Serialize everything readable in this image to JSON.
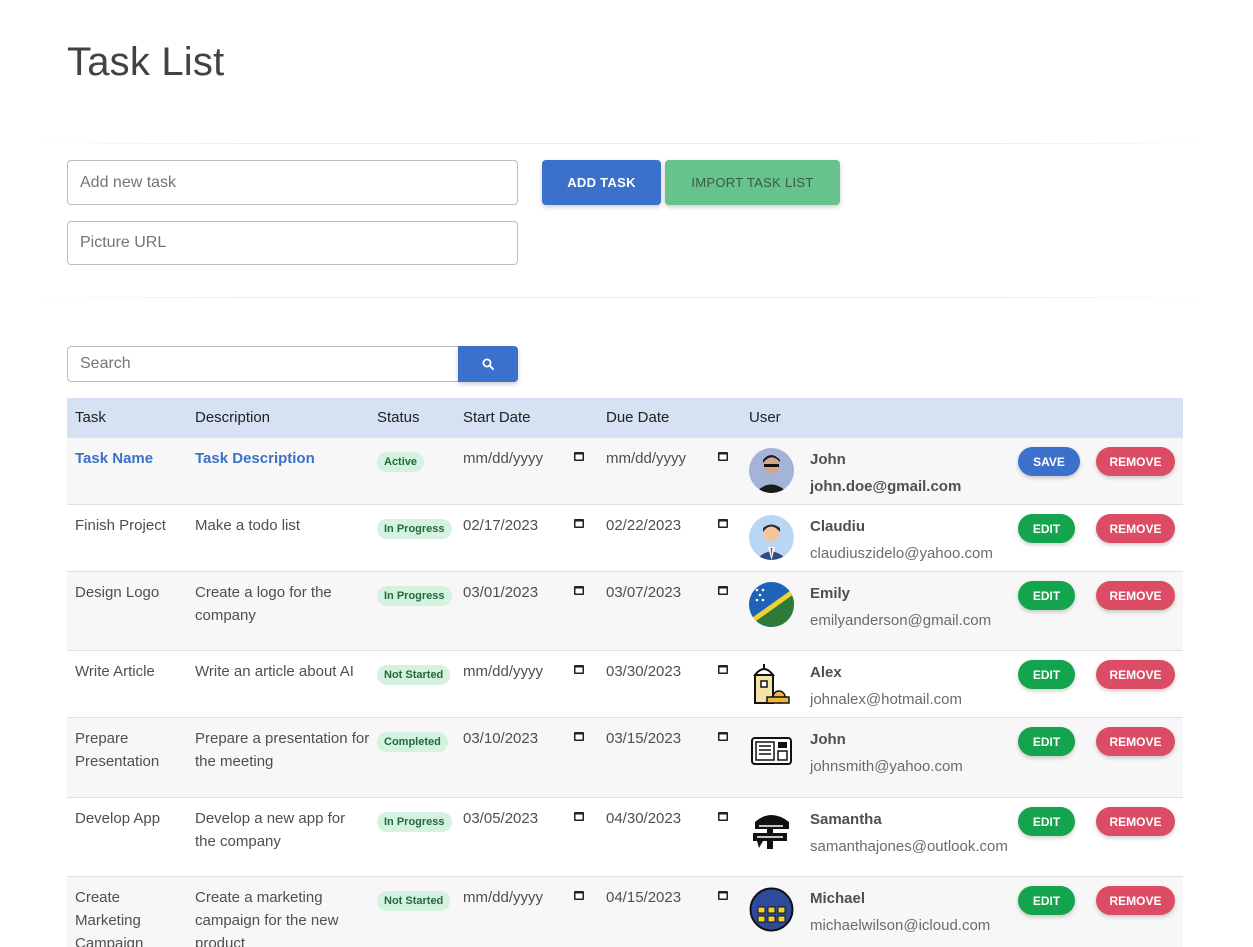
{
  "page": {
    "title": "Task List"
  },
  "form": {
    "task_placeholder": "Add new task",
    "task_value": "",
    "picture_placeholder": "Picture URL",
    "picture_value": "",
    "add_label": "ADD TASK",
    "import_label": "IMPORT TASK LIST"
  },
  "search": {
    "placeholder": "Search",
    "value": ""
  },
  "table": {
    "headers": [
      "Task",
      "Description",
      "Status",
      "Start Date",
      "Due Date",
      "User"
    ],
    "new_row": {
      "task": "Task Name",
      "description": "Task Description",
      "status": "Active",
      "start_date": "mm/dd/yyyy",
      "due_date": "mm/dd/yyyy",
      "user_name": "John",
      "user_email": "john.doe@gmail.com",
      "avatar": "person-sunglasses-avatar",
      "save_label": "SAVE",
      "remove_label": "REMOVE"
    },
    "rows": [
      {
        "task": "Finish Project",
        "description": "Make a todo list",
        "status": "In Progress",
        "start_date": "02/17/2023",
        "due_date": "02/22/2023",
        "user_name": "Claudiu",
        "user_email": "claudiuszidelo@yahoo.com",
        "avatar": "businessman-avatar",
        "edit_label": "EDIT",
        "remove_label": "REMOVE"
      },
      {
        "task": "Design Logo",
        "description": "Create a logo for the company",
        "status": "In Progress",
        "start_date": "03/01/2023",
        "due_date": "03/07/2023",
        "user_name": "Emily",
        "user_email": "emilyanderson@gmail.com",
        "avatar": "flag-avatar",
        "edit_label": "EDIT",
        "remove_label": "REMOVE"
      },
      {
        "task": "Write Article",
        "description": "Write an article about AI",
        "status": "Not Started",
        "start_date": "mm/dd/yyyy",
        "due_date": "03/30/2023",
        "user_name": "Alex",
        "user_email": "johnalex@hotmail.com",
        "avatar": "lighthouse-avatar",
        "edit_label": "EDIT",
        "remove_label": "REMOVE"
      },
      {
        "task": "Prepare Presentation",
        "description": "Prepare a presentation for the meeting",
        "status": "Completed",
        "start_date": "03/10/2023",
        "due_date": "03/15/2023",
        "user_name": "John",
        "user_email": "johnsmith@yahoo.com",
        "avatar": "radio-avatar",
        "edit_label": "EDIT",
        "remove_label": "REMOVE"
      },
      {
        "task": "Develop App",
        "description": "Develop a new app for the company",
        "status": "In Progress",
        "start_date": "03/05/2023",
        "due_date": "04/30/2023",
        "user_name": "Samantha",
        "user_email": "samanthajones@outlook.com",
        "avatar": "signpost-avatar",
        "edit_label": "EDIT",
        "remove_label": "REMOVE"
      },
      {
        "task": "Create Marketing Campaign",
        "description": "Create a marketing campaign for the new product",
        "status": "Not Started",
        "start_date": "mm/dd/yyyy",
        "due_date": "04/15/2023",
        "user_name": "Michael",
        "user_email": "michaelwilson@icloud.com",
        "avatar": "calendar-avatar",
        "edit_label": "EDIT",
        "remove_label": "REMOVE"
      }
    ]
  },
  "colors": {
    "primary": "#3b71ca",
    "success": "#14a44d",
    "danger": "#dc4c64",
    "header_bg": "#d6e1f3",
    "import": "#66c38b"
  }
}
